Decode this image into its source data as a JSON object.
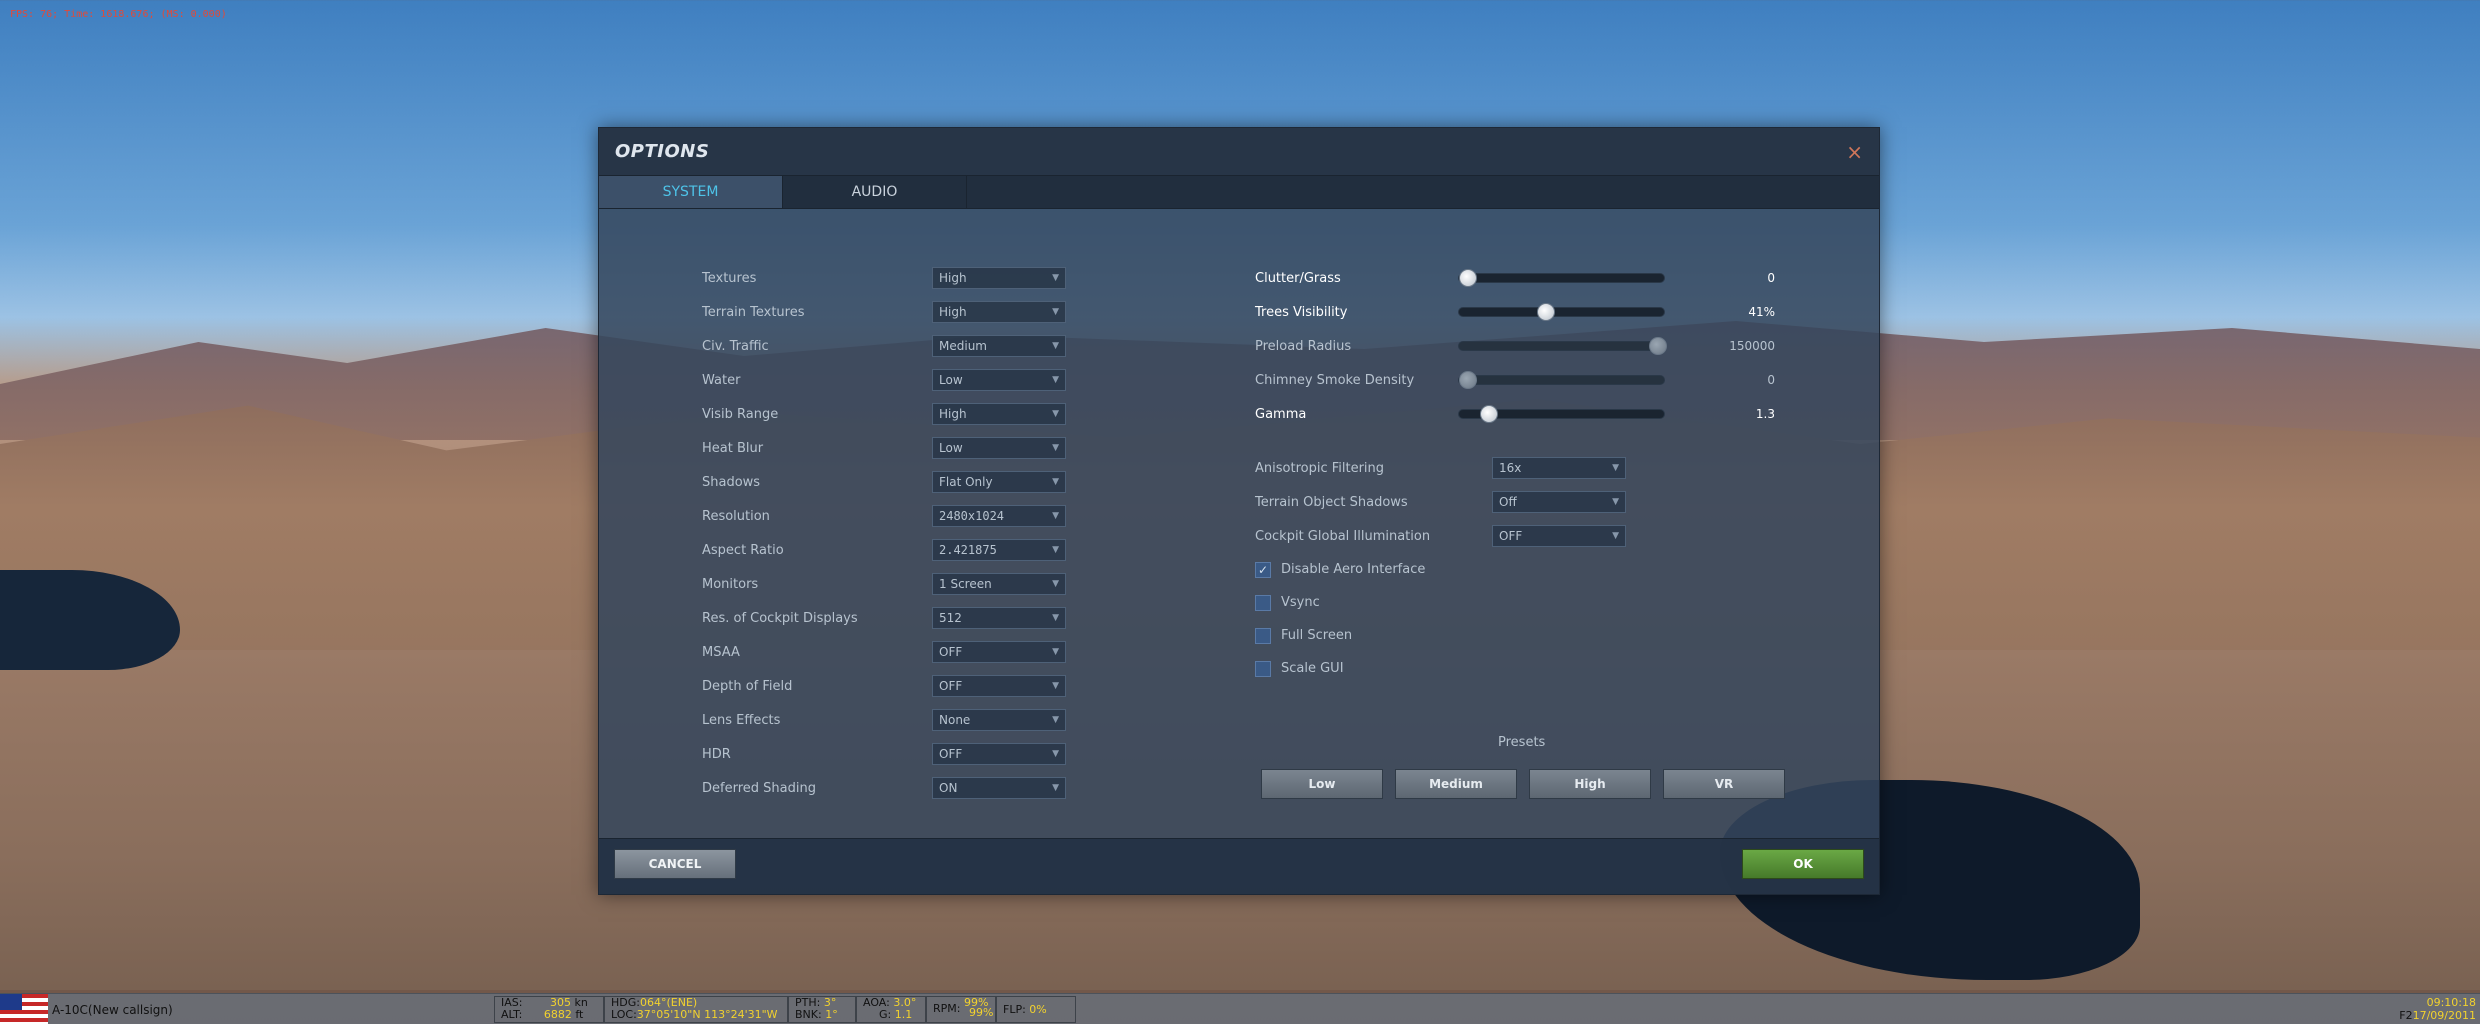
{
  "fps_text": "FPS: 76; Time: 1618.676; (MS: 0.000)",
  "dialog": {
    "title": "OPTIONS",
    "close_icon": "×",
    "tabs": [
      {
        "label": "SYSTEM"
      },
      {
        "label": "AUDIO"
      }
    ]
  },
  "left_settings": [
    {
      "label": "Textures",
      "value": "High"
    },
    {
      "label": "Terrain Textures",
      "value": "High"
    },
    {
      "label": "Civ. Traffic",
      "value": "Medium"
    },
    {
      "label": "Water",
      "value": "Low"
    },
    {
      "label": "Visib Range",
      "value": "High"
    },
    {
      "label": "Heat Blur",
      "value": "Low"
    },
    {
      "label": "Shadows",
      "value": "Flat Only"
    },
    {
      "label": "Resolution",
      "value": "2480x1024"
    },
    {
      "label": "Aspect Ratio",
      "value": "2.421875"
    },
    {
      "label": "Monitors",
      "value": "1 Screen"
    },
    {
      "label": "Res. of Cockpit Displays",
      "value": "512"
    },
    {
      "label": "MSAA",
      "value": "OFF"
    },
    {
      "label": "Depth of Field",
      "value": "OFF"
    },
    {
      "label": "Lens Effects",
      "value": "None"
    },
    {
      "label": "HDR",
      "value": "OFF"
    },
    {
      "label": "Deferred Shading",
      "value": "ON"
    }
  ],
  "sliders": [
    {
      "label": "Clutter/Grass",
      "value": "0",
      "level": 0.0,
      "active": true
    },
    {
      "label": "Trees Visibility",
      "value": "41%",
      "level": 0.41,
      "active": true
    },
    {
      "label": "Preload Radius",
      "value": "150000",
      "level": 1.0,
      "active": false
    },
    {
      "label": "Chimney Smoke Density",
      "value": "0",
      "level": 0.0,
      "active": false
    },
    {
      "label": "Gamma",
      "value": "1.3",
      "level": 0.11,
      "active": true
    }
  ],
  "right_selects": [
    {
      "label": "Anisotropic Filtering",
      "value": "16x"
    },
    {
      "label": "Terrain Object Shadows",
      "value": "Off"
    },
    {
      "label": "Cockpit Global Illumination",
      "value": "OFF"
    }
  ],
  "checkboxes": [
    {
      "label": "Disable Aero Interface",
      "checked": true
    },
    {
      "label": "Vsync",
      "checked": false
    },
    {
      "label": "Full Screen",
      "checked": false
    },
    {
      "label": "Scale GUI",
      "checked": false
    }
  ],
  "presets": {
    "label": "Presets",
    "buttons": [
      "Low",
      "Medium",
      "High",
      "VR"
    ]
  },
  "footer": {
    "cancel": "CANCEL",
    "ok": "OK"
  },
  "hud": {
    "callsign": "A-10C(New callsign)",
    "ias_label": "IAS:",
    "ias_value": "305",
    "ias_unit": "kn",
    "alt_label": "ALT:",
    "alt_value": "6882",
    "alt_unit": "ft",
    "hdg_label": "HDG:",
    "hdg_value": "064°(ENE)",
    "loc_label": "LOC:",
    "loc_value": "37°05'10\"N 113°24'31\"W",
    "pth_label": "PTH:",
    "pth_value": "3°",
    "bnk_label": "BNK:",
    "bnk_value": "1°",
    "aoa_label": "AOA:",
    "aoa_value": "3.0°",
    "g_label": "G:",
    "g_value": "1.1",
    "rpm_label": "RPM:",
    "rpm_value1": "99%",
    "rpm_value2": "99%",
    "flp_label": "FLP:",
    "flp_value": "0%",
    "time_prefix": "",
    "time": "09:10:18",
    "date_prefix": "F2",
    "date": "17/09/2011"
  },
  "colors": {
    "accent_tab": "#4ec3e8",
    "ok_button": "#5a9438",
    "hud_yellow": "#f2d22e",
    "close_icon": "#d0765a"
  }
}
